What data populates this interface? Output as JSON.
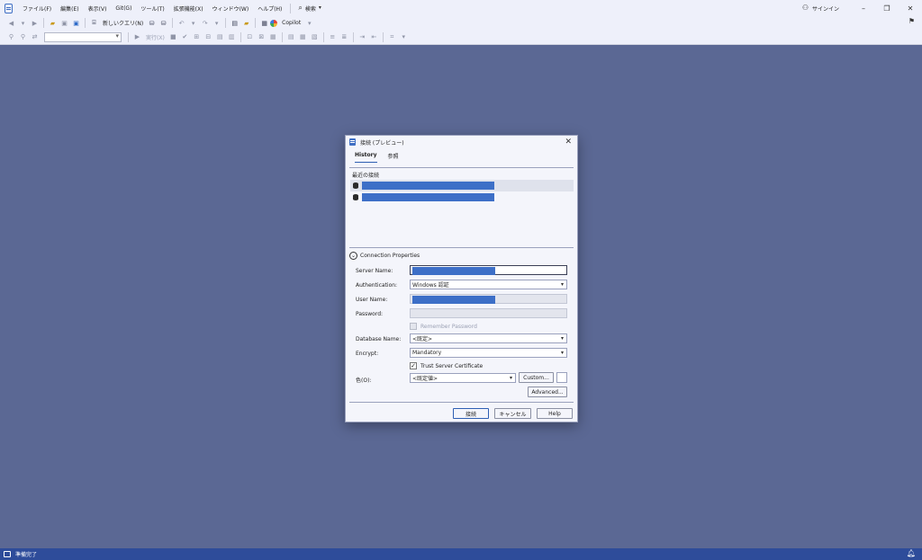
{
  "menubar": {
    "items": [
      "ファイル(F)",
      "編集(E)",
      "表示(V)",
      "Git(G)",
      "ツール(T)",
      "拡張機能(X)",
      "ウィンドウ(W)",
      "ヘルプ(H)"
    ],
    "search_label": "検索",
    "signin_label": "サインイン"
  },
  "toolbar": {
    "new_query_label": "新しいクエリ(N)",
    "copilot_label": "Copilot",
    "execute_label": "実行(X)",
    "database_combo_value": ""
  },
  "statusbar": {
    "text": "準備完了"
  },
  "dialog": {
    "title": "接続 (プレビュー)",
    "tabs": [
      "History",
      "参照"
    ],
    "recent_label": "最近の接続",
    "connection_properties_label": "Connection Properties",
    "labels": {
      "server_name": "Server Name:",
      "authentication": "Authentication:",
      "user_name": "User Name:",
      "password": "Password:",
      "database_name": "Database Name:",
      "encrypt": "Encrypt:",
      "color": "色(O):"
    },
    "values": {
      "server_name": "",
      "authentication": "Windows 認証",
      "user_name": "",
      "password": "",
      "database_name": "<既定>",
      "encrypt": "Mandatory",
      "color": "<既定値>"
    },
    "remember_password_label": "Remember Password",
    "remember_password_checked": false,
    "trust_server_certificate_label": "Trust Server Certificate",
    "trust_server_certificate_checked": true,
    "custom_button": "Custom...",
    "advanced_button": "Advanced...",
    "connect_button": "接続",
    "cancel_button": "キャンセル",
    "help_button": "Help"
  },
  "colors": {
    "accent": "#2f5fb3",
    "background": "#5b6894",
    "statusbar": "#2e4c9a",
    "redaction": "#3d6fc7"
  }
}
